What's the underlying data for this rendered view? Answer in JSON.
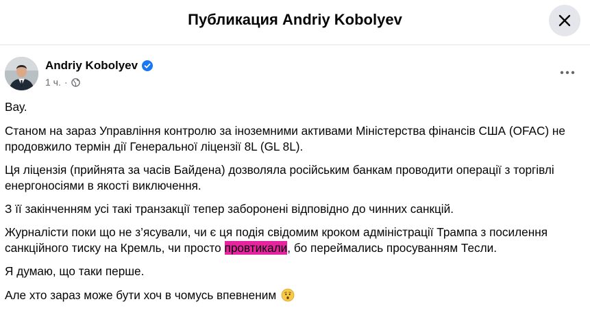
{
  "dialog": {
    "title": "Публикация Andriy Kobolyev",
    "close_icon": "close-icon"
  },
  "post": {
    "author": "Andriy Kobolyev",
    "verified_icon": "verified-badge-icon",
    "time": "1 ч.",
    "meta_separator": "·",
    "audience_icon": "globe-icon",
    "more_icon": "more-horizontal-icon",
    "paragraphs": {
      "p1": "Вау.",
      "p2": "Станом на зараз Управління контролю за іноземними активами Міністерства фінансів США (OFAC) не продовжило термін дії Генеральної ліцензії 8L (GL 8L).",
      "p3": "Ця ліцензія (прийнята за часів Байдена)  дозволяла російським банкам проводити операції з торгівлі енергоносіями в якості виключення.",
      "p4": "З її закінченням усі такі транзакції тепер заборонені відповідно до чинних санкцій.",
      "p5_before": "Журналісти поки що не з’ясували, чи є ця подія свідомим кроком адміністрації Трампа з посилення санкційного тиску на Кремль, чи просто ",
      "p5_highlight": "провтикали",
      "p5_after": ", бо переймались просуванням Тесли.",
      "p6": "Я думаю, що таки перше.",
      "p7": "Але хто зараз може бути хоч в чомусь впевненим"
    },
    "emoji_icon": "worried-face-emoji-icon",
    "highlight_color": "#e6249f"
  },
  "colors": {
    "text": "#050505",
    "secondary": "#65676b",
    "verified": "#1877f2",
    "close_bg": "#e4e6eb"
  }
}
